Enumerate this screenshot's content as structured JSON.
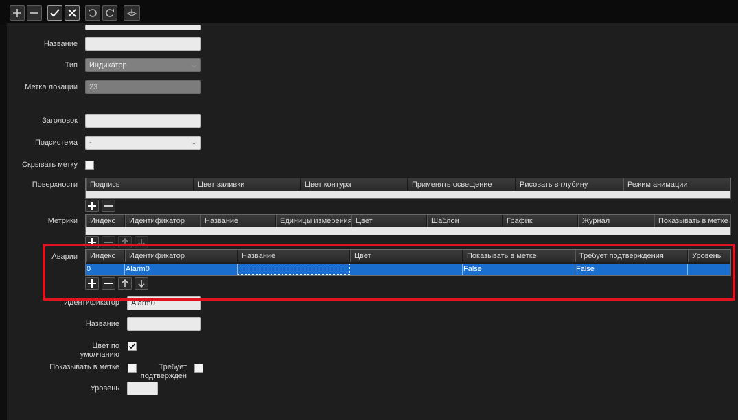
{
  "toolbar": {
    "buttons": [
      {
        "name": "add-button",
        "icon": "plus-icon"
      },
      {
        "name": "remove-button",
        "icon": "minus-icon"
      },
      {
        "name": "apply-button",
        "icon": "check-icon"
      },
      {
        "name": "cancel-button",
        "icon": "x-icon"
      },
      {
        "name": "undo-button",
        "icon": "undo-icon"
      },
      {
        "name": "redo-button",
        "icon": "redo-icon"
      },
      {
        "name": "layers-button",
        "icon": "layers-icon"
      }
    ]
  },
  "form": {
    "name_label": "Название",
    "name_value": "",
    "type_label": "Тип",
    "type_value": "Индикатор",
    "location_label": "Метка локации",
    "location_value": "23",
    "header_label": "Заголовок",
    "header_value": "",
    "subsystem_label": "Подсистема",
    "subsystem_value": "-",
    "hide_label_label": "Скрывать метку",
    "hide_label_checked": false
  },
  "surfaces": {
    "label": "Поверхности",
    "columns": [
      "Подпись",
      "Цвет заливки",
      "Цвет контура",
      "Применять освещение",
      "Рисовать в глубину",
      "Режим анимации"
    ]
  },
  "metrics": {
    "label": "Метрики",
    "columns": [
      "Индекс",
      "Идентификатор",
      "Название",
      "Единицы измерения",
      "Цвет",
      "Шаблон",
      "График",
      "Журнал",
      "Показывать в метке"
    ]
  },
  "alarms": {
    "label": "Аварии",
    "columns": [
      "Индекс",
      "Идентификатор",
      "Название",
      "Цвет",
      "Показывать в метке",
      "Требует подтверждения",
      "Уровень"
    ],
    "rows": [
      {
        "index": "0",
        "identifier": "Alarm0",
        "name": "",
        "color": "",
        "show_in_label": "False",
        "requires_ack": "False",
        "level": ""
      }
    ]
  },
  "alarm_detail": {
    "identifier_label": "Идентификатор",
    "identifier_value": "Alarm0",
    "name_label": "Название",
    "name_value": "",
    "default_color_label": "Цвет по умолчанию",
    "default_color_checked": true,
    "show_in_label_label": "Показывать в метке",
    "show_in_label_checked": false,
    "requires_ack_label": "Требует подтвержден",
    "requires_ack_checked": false,
    "level_label": "Уровень",
    "level_value": ""
  },
  "colors": {
    "selection": "#1a6fce",
    "highlight": "#e0141e",
    "panel": "#1e1e1e"
  }
}
